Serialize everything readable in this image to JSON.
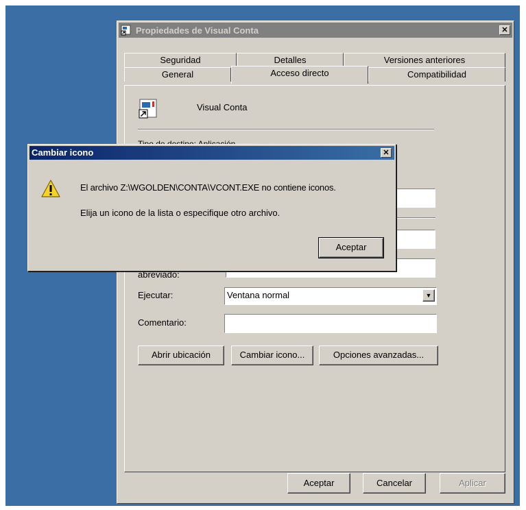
{
  "window": {
    "title": "Propiedades de Visual Conta",
    "close_glyph": "✕",
    "tabs_row1": [
      "Seguridad",
      "Detalles",
      "Versiones anteriores"
    ],
    "tabs_row2": [
      "General",
      "Acceso directo",
      "Compatibilidad"
    ],
    "active_tab": "Acceso directo",
    "shortcut_name": "Visual Conta",
    "partial_label": "Tipo de destino:  Aplicación",
    "abbrev_label": "abreviado:",
    "ejecutar_label": "Ejecutar:",
    "ejecutar_value": "Ventana normal",
    "comentario_label": "Comentario:",
    "comentario_value": "",
    "buttons": {
      "abrir": "Abrir ubicación",
      "cambiar": "Cambiar icono...",
      "opciones": "Opciones avanzadas..."
    },
    "footer": {
      "aceptar": "Aceptar",
      "cancelar": "Cancelar",
      "aplicar": "Aplicar"
    }
  },
  "dialog": {
    "title": "Cambiar icono",
    "close_glyph": "✕",
    "message1": "El archivo Z:\\WGOLDEN\\CONTA\\VCONT.EXE no contiene iconos.",
    "message2": "Elija un icono de la lista o especifique otro archivo.",
    "ok": "Aceptar"
  },
  "colors": {
    "desktop": "#3a6ea5",
    "face": "#d4d0c8",
    "title_active": "#0a246a",
    "title_inactive": "#808080"
  }
}
